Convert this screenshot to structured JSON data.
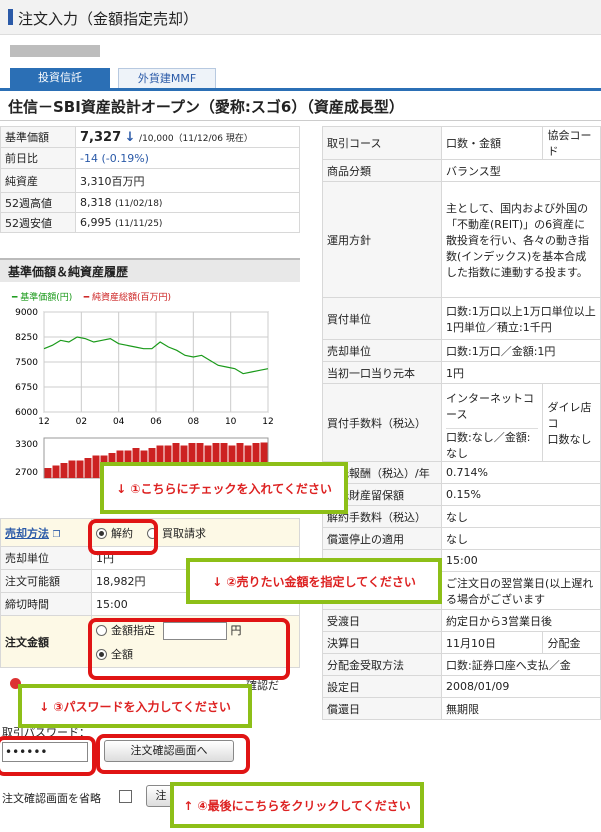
{
  "page_title": "注文入力（金額指定売却）",
  "tabs": [
    "投資信託",
    "外貨建MMF"
  ],
  "fund_name": "住信－SBI資産設計オープン（愛称:スゴ6）（資産成長型）",
  "info": {
    "nav_label": "基準価額",
    "nav_value": "7,327",
    "nav_arrow": "↓",
    "nav_detail": "/10,000（11/12/06 現在）",
    "change_label": "前日比",
    "change_value": "-14 (-0.19%)",
    "assets_label": "純資産",
    "assets_value": "3,310百万円",
    "high_label": "52週高値",
    "high_value": "8,318",
    "high_date": "(11/02/18)",
    "low_label": "52週安値",
    "low_value": "6,995",
    "low_date": "(11/11/25)"
  },
  "chart": {
    "heading": "基準価額＆純資産履歴",
    "legend_nav": "━ 基準価額(円)",
    "legend_assets": "━ 純資産総額(百万円)"
  },
  "chart_data": {
    "type": "line",
    "x_ticks": [
      "12",
      "02",
      "04",
      "06",
      "08",
      "10",
      "12"
    ],
    "y_ticks": [
      "9000",
      "8250",
      "7500",
      "6750",
      "6000"
    ],
    "ylim": [
      6000,
      9000
    ],
    "series": [
      {
        "name": "基準価額(円)",
        "color": "#1a9a1a",
        "values": [
          7900,
          8000,
          8150,
          8100,
          8250,
          8200,
          8100,
          8150,
          8200,
          8050,
          8000,
          7950,
          7900,
          7900,
          8100,
          7950,
          7850,
          7700,
          7650,
          7700,
          7550,
          7400,
          7350,
          7300,
          7150,
          7200,
          7250,
          7300
        ]
      }
    ],
    "bars": {
      "name": "純資産総額(百万円)",
      "color": "#cc2222",
      "y_ticks": [
        "3300",
        "2700"
      ],
      "values": [
        2800,
        2850,
        2900,
        2950,
        2950,
        3000,
        3050,
        3050,
        3100,
        3150,
        3150,
        3200,
        3150,
        3200,
        3250,
        3250,
        3300,
        3250,
        3300,
        3300,
        3250,
        3300,
        3300,
        3250,
        3300,
        3250,
        3300,
        3310
      ]
    }
  },
  "right_rows": [
    {
      "label": "取引コース",
      "value": "口数・金額",
      "extra": "協会コード"
    },
    {
      "label": "商品分類",
      "value": "バランス型"
    },
    {
      "label": "運用方針",
      "value": "主として、国内および外国の「不動産(REIT)」の6資産に散投資を行い、各々の動き指数(インデックス)を基本合成した指数に連動する投ます。"
    },
    {
      "label": "買付単位",
      "value": "口数:1万口以上1万口単位以上1円単位／積立:1千円"
    },
    {
      "label": "売却単位",
      "value": "口数:1万口／金額:1円"
    },
    {
      "label": "当初一口当り元本",
      "value": "1円"
    },
    {
      "label": "買付手数料（税込）",
      "value": "インターネットコース",
      "value2": "口数:なし／金額:なし",
      "extra": "ダイレ店コ",
      "extra2": "口数なし"
    },
    {
      "label": "信託報酬（税込）/年",
      "value": "0.714%"
    },
    {
      "label": "信託財産留保額",
      "value": "0.15%"
    },
    {
      "label": "解約手数料（税込）",
      "value": "なし"
    },
    {
      "label": "償還停止の適用",
      "value": "なし"
    },
    {
      "label": "",
      "value": "15:00"
    },
    {
      "label": "約定日",
      "value": "ご注文日の翌営業日(以上遅れる場合がございます"
    },
    {
      "label": "受渡日",
      "value": "約定日から3営業日後"
    },
    {
      "label": "決算日",
      "value": "11月10日",
      "extra": "分配金"
    },
    {
      "label": "分配金受取方法",
      "value": "口数:証券口座へ支払／金"
    },
    {
      "label": "設定日",
      "value": "2008/01/09"
    },
    {
      "label": "償還日",
      "value": "無期限"
    }
  ],
  "order": {
    "method_label": "売却方法",
    "method_opt1": "解約",
    "method_opt2": "買取請求",
    "unit_label": "売却単位",
    "unit_value": "1円",
    "available_label": "注文可能額",
    "available_value": "18,982円",
    "cutoff_label": "締切時間",
    "cutoff_value": "15:00",
    "amount_label": "注文金額",
    "amount_opt1": "金額指定",
    "amount_unit": "円",
    "amount_opt2": "全額",
    "confirm_text": "確認だ",
    "password_label": "取引パスワード：",
    "password_value": "••••••",
    "confirm_button": "注文確認画面へ",
    "skip_label": "注文確認画面を省略",
    "skip_button": "注"
  },
  "callouts": {
    "c1": "↓ ①こちらにチェックを入れてください",
    "c2": "↓ ②売りたい金額を指定してください",
    "c3": "↓ ③パスワードを入力してください",
    "c4": "↑ ④最後にこちらをクリックしてください"
  }
}
